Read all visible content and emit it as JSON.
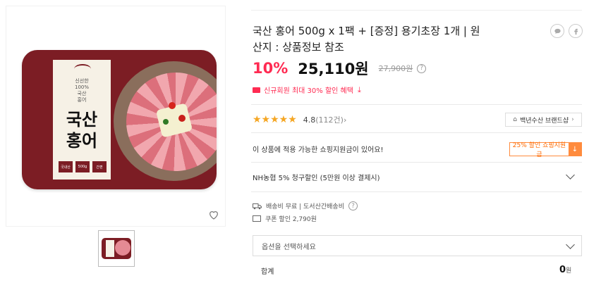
{
  "product_image": {
    "label_small": "신선한\n100%\n국산\n홍어",
    "label_title": "국산\n홍어",
    "label_tags": [
      "국내산",
      "500g",
      "간편"
    ]
  },
  "product": {
    "title": "국산 홍어 500g x 1팩 + [증정] 용기초장 1개 | 원산지 : 상품정보 참조",
    "discount": "10%",
    "price": "25,110원",
    "original_price": "27,900원",
    "coupon_text": "신규회원 최대 30% 할인 혜택"
  },
  "share_icons": [
    "speech-bubble-icon",
    "facebook-icon"
  ],
  "rating": {
    "stars": "★★★★★",
    "score": "4.8",
    "reviews": "(112건)",
    "arrow": "›"
  },
  "brand": {
    "label": "백년수산 브랜드샵",
    "arrow": "›"
  },
  "shopping_notice": {
    "text": "이 상품에 적용 가능한 쇼핑지원금이 있어요!",
    "button_label": "25% 할인 쇼핑지원금",
    "button_icon": "↓"
  },
  "card_benefit": "NH농협 5% 청구할인 (5만원 이상 결제시)",
  "shipping": {
    "text": "배송비 무료 | 도서산간배송비"
  },
  "coupon_discount": "쿠폰 할인 2,790원",
  "option_placeholder": "옵션을 선택하세요",
  "total": {
    "label": "합계",
    "value": "0",
    "unit": "원"
  },
  "colors": {
    "accent": "#ff2b52",
    "orange": "#ff8b3d",
    "tray": "#7c1d24",
    "star": "#f5a623"
  }
}
